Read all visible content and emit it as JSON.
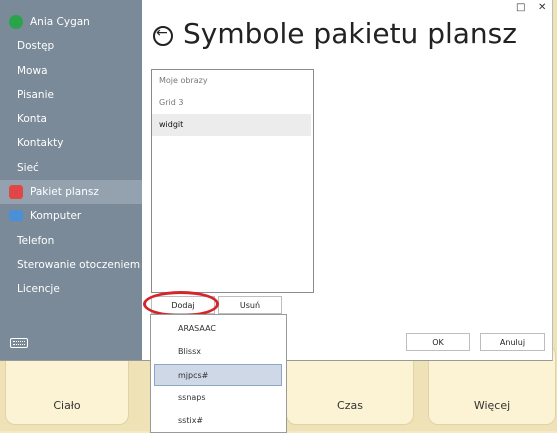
{
  "window": {
    "title": "Symbole pakietu plansz"
  },
  "sidebar": {
    "user": "Ania Cygan",
    "items": [
      {
        "label": "Dostęp"
      },
      {
        "label": "Mowa"
      },
      {
        "label": "Pisanie"
      },
      {
        "label": "Konta"
      },
      {
        "label": "Kontakty"
      },
      {
        "label": "Sieć"
      },
      {
        "label": "Pakiet plansz"
      },
      {
        "label": "Komputer"
      },
      {
        "label": "Telefon"
      },
      {
        "label": "Sterowanie otoczeniem"
      },
      {
        "label": "Licencje"
      }
    ]
  },
  "list": {
    "items": [
      "Moje obrazy",
      "Grid 3",
      "widgit"
    ]
  },
  "buttons": {
    "add": "Dodaj",
    "remove": "Usuń",
    "ok": "OK",
    "cancel": "Anuluj"
  },
  "dropdown": {
    "items": [
      "ARASAAC",
      "Blissx",
      "mjpcs#",
      "ssnaps",
      "sstix#"
    ]
  },
  "background_tiles": [
    "Ciało",
    "Czas",
    "Więcej"
  ],
  "colors": {
    "sidebar": "#7a8a98",
    "highlight_ring": "#d3262c",
    "selected_option": "#cfd8e6"
  }
}
